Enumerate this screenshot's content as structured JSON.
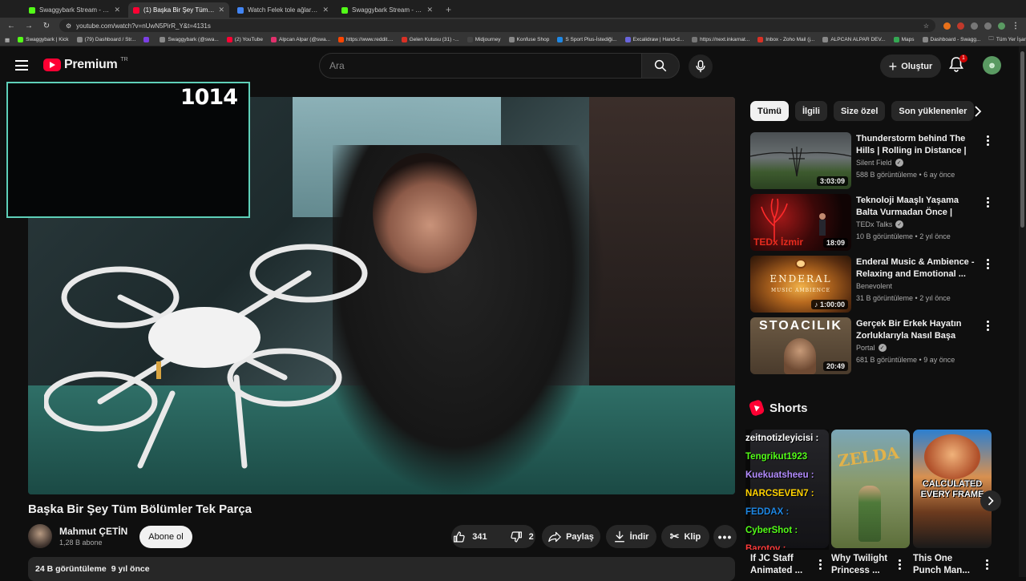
{
  "browser": {
    "tabs": [
      {
        "title": "Swaggybark Stream - Watch Li...",
        "color": "#53fc18",
        "active": false
      },
      {
        "title": "(1) Başka Bir Şey Tüm Bölü...",
        "color": "#ff0033",
        "active": true
      },
      {
        "title": "Watch Felek tole ağlar oldu | ...",
        "color": "#4285f4",
        "active": false
      },
      {
        "title": "Swaggybark Stream - Watch Li...",
        "color": "#53fc18",
        "active": false
      }
    ],
    "url": "youtube.com/watch?v=nUwN5PirR_Y&t=4131s",
    "bookmarks": [
      "Swaggybark | Kick",
      "(79) Dashboard / Str...",
      "",
      "Swaggybark (@swa...",
      "(2) YouTube",
      "Alpcan Alpar (@swa...",
      "https://www.reddit....",
      "Gelen Kutusu (31) -...",
      "Midjourney",
      "Konfuse Shop",
      "S Sport Plus-İstediği...",
      "Excalidraw | Hand-d...",
      "https://next.inkarnat...",
      "Inbox - Zoho Mail (j...",
      "ALPCAN ALPAR DEV...",
      "Maps",
      "Dashboard - Swagg..."
    ],
    "bookmarks_right": "Tüm Yer İşaretleri"
  },
  "header": {
    "logo_text": "Premium",
    "country_code": "TR",
    "search_placeholder": "Ara",
    "create_label": "Oluştur",
    "notification_count": "1"
  },
  "player": {
    "overlay_number": "1014"
  },
  "video": {
    "title": "Başka Bir Şey Tüm Bölümler Tek Parça",
    "channel": "Mahmut ÇETİN",
    "subscribers": "1,28 B abone",
    "subscribe_label": "Abone ol",
    "likes": "341",
    "dislikes": "2",
    "share_label": "Paylaş",
    "download_label": "İndir",
    "clip_label": "Klip",
    "views": "24 B görüntüleme",
    "age": "9 yıl önce"
  },
  "chips": [
    "Tümü",
    "İlgili",
    "Size özel",
    "Son yüklenenler"
  ],
  "recommendations": [
    {
      "title": "Thunderstorm behind The Hills | Rolling in Distance | Calm ...",
      "channel": "Silent Field",
      "verified": true,
      "meta": "588 B görüntüleme • 6 ay önce",
      "duration": "3:03:09"
    },
    {
      "title": "Teknoloji Maaşlı Yaşama Balta Vurmadan Önce | Kadir Köyme...",
      "channel": "TEDx Talks",
      "verified": true,
      "meta": "10 B görüntüleme • 2 yıl önce",
      "duration": "18:09",
      "thumb_text": "TEDx İzmir"
    },
    {
      "title": "Enderal Music & Ambience - Relaxing and Emotional ...",
      "channel": "Benevolent",
      "verified": false,
      "meta": "31 B görüntüleme • 2 yıl önce",
      "duration": "1:00:00",
      "thumb_text": "ENDERAL",
      "thumb_sub": "MUSIC AMBIENCE"
    },
    {
      "title": "Gerçek Bir Erkek Hayatın Zorluklarıyla Nasıl Başa Çıkar?",
      "channel": "Portal",
      "verified": true,
      "meta": "681 B görüntüleme • 9 ay önce",
      "duration": "20:49",
      "thumb_text": "STOACILIK"
    }
  ],
  "shorts": {
    "heading": "Shorts",
    "chat": [
      {
        "text": "zeitnotizleyicisi :",
        "color": "#ffffff"
      },
      {
        "text": "Tengrikut1923",
        "color": "#53fc18"
      },
      {
        "text": "Kuekuatsheeu :",
        "color": "#b38cff"
      },
      {
        "text": "NARCSEVEN7 :",
        "color": "#ffd200"
      },
      {
        "text": "FEDDAX :",
        "color": "#1e88e5"
      },
      {
        "text": "CyberShot :",
        "color": "#53fc18"
      },
      {
        "text": "Barotov :",
        "color": "#ff3b3b"
      }
    ],
    "items": [
      {
        "title": "If JC Staff Animated ..."
      },
      {
        "title": "Why Twilight Princess ..."
      },
      {
        "title": "This One Punch Man..."
      }
    ],
    "zelda_text": "ZELDA",
    "calculated_text": "CALCULATED EVERY FRAME"
  }
}
